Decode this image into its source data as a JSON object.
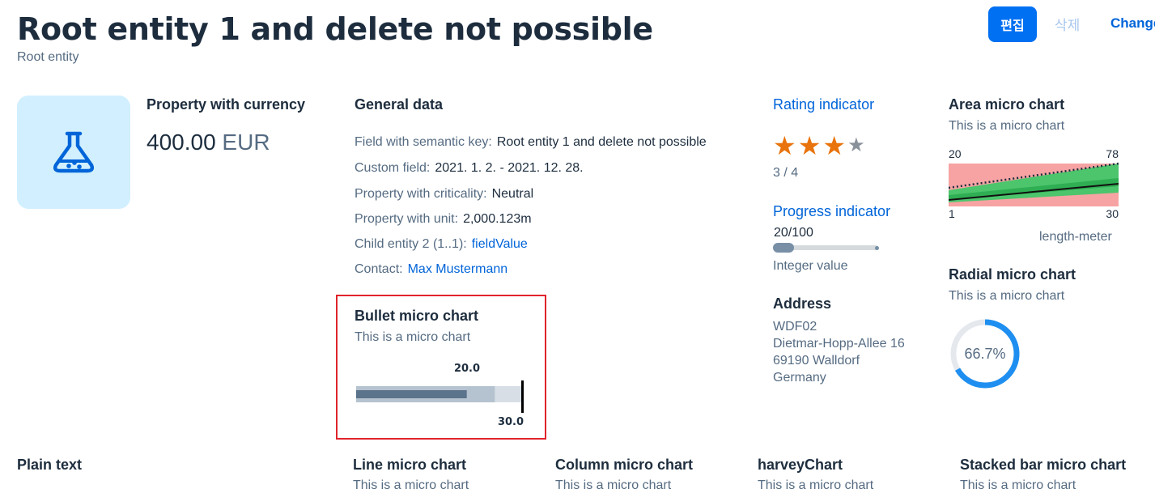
{
  "header": {
    "title": "Root entity 1 and delete not possible",
    "subtitle": "Root entity",
    "actions": {
      "edit": "편집",
      "delete": "삭제",
      "change": "Change"
    }
  },
  "avatar": {
    "icon": "flask-icon",
    "color": "#0064d9",
    "bg": "#d1efff"
  },
  "currency": {
    "label": "Property with currency",
    "value": "400.00",
    "unit": "EUR"
  },
  "general": {
    "title": "General data",
    "fields": [
      {
        "label": "Field with semantic key:",
        "value": "Root entity 1 and delete not possible"
      },
      {
        "label": "Custom field:",
        "value": "2021. 1. 2. - 2021. 12. 28."
      },
      {
        "label": "Property with criticality:",
        "value": "Neutral"
      },
      {
        "label": "Property with unit:",
        "value": "2,000.123m"
      },
      {
        "label": "Child entity 2 (1..1):",
        "value": "fieldValue"
      },
      {
        "label": "Contact:",
        "value": "Max Mustermann"
      }
    ]
  },
  "bullet": {
    "title": "Bullet micro chart",
    "subtitle": "This is a micro chart",
    "target_label": "20.0",
    "max_label": "30.0",
    "actual_fraction": 0.67,
    "forecast_fraction": 0.84,
    "target_fraction": 1.0
  },
  "rating": {
    "title": "Rating indicator",
    "value": 3,
    "max": 4,
    "text": "3 / 4",
    "filled_color": "#e9730c",
    "empty_color": "#89919a"
  },
  "progress": {
    "title": "Progress indicator",
    "text": "20/100",
    "percent": 20,
    "caption": "Integer value"
  },
  "address": {
    "title": "Address",
    "lines": [
      "WDF02",
      "Dietmar-Hopp-Allee 16",
      "69190 Walldorf",
      "Germany"
    ]
  },
  "area": {
    "title": "Area micro chart",
    "subtitle": "This is a micro chart",
    "top_left": "20",
    "top_right": "78",
    "bottom_left": "1",
    "bottom_right": "30",
    "unit": "length-meter"
  },
  "radial": {
    "title": "Radial micro chart",
    "subtitle": "This is a micro chart",
    "value_text": "66.7%",
    "percent": 66.7,
    "color": "#1e8ff0"
  },
  "bottom": {
    "plain_text": "Plain text",
    "cards": [
      {
        "title": "Line micro chart",
        "subtitle": "This is a micro chart"
      },
      {
        "title": "Column micro chart",
        "subtitle": "This is a micro chart"
      },
      {
        "title": "harveyChart",
        "subtitle": "This is a micro chart"
      },
      {
        "title": "Stacked bar micro chart",
        "subtitle": "This is a micro chart"
      }
    ]
  }
}
